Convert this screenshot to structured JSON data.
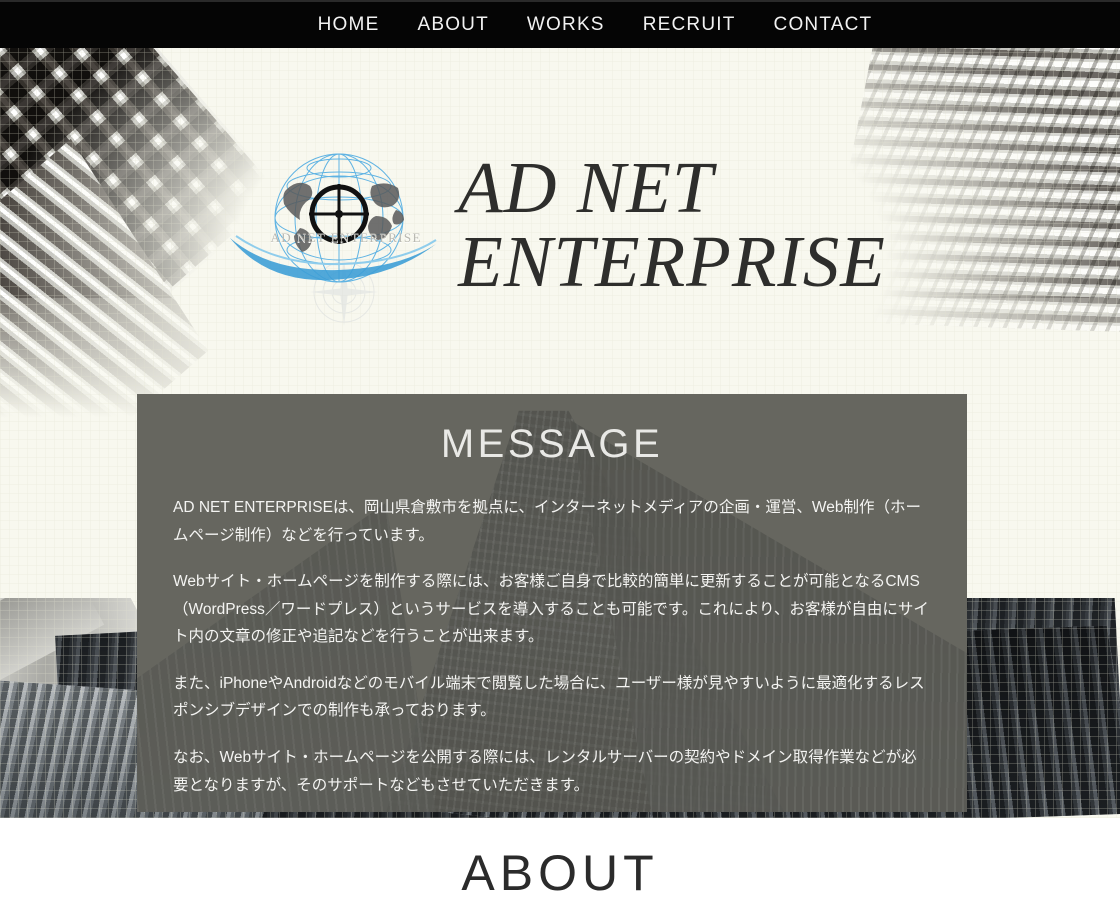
{
  "nav": {
    "items": [
      {
        "label": "HOME"
      },
      {
        "label": "ABOUT"
      },
      {
        "label": "WORKS"
      },
      {
        "label": "RECRUIT"
      },
      {
        "label": "CONTACT"
      }
    ]
  },
  "brand": {
    "logo_text": "AD NET ENTERPRISE",
    "wordmark_line1": "AD NET",
    "wordmark_line2": "ENTERPRISE"
  },
  "message": {
    "heading": "MESSAGE",
    "paragraphs": [
      "AD NET ENTERPRISEは、岡山県倉敷市を拠点に、インターネットメディアの企画・運営、Web制作（ホームページ制作）などを行っています。",
      "Webサイト・ホームページを制作する際には、お客様ご自身で比較的簡単に更新することが可能となるCMS（WordPress／ワードプレス）というサービスを導入することも可能です。これにより、お客様が自由にサイト内の文章の修正や追記などを行うことが出来ます。",
      "また、iPhoneやAndroidなどのモバイル端末で閲覧した場合に、ユーザー様が見やすいように最適化するレスポンシブデザインでの制作も承っております。",
      "なお、Webサイト・ホームページを公開する際には、レンタルサーバーの契約やドメイン取得作業などが必要となりますが、そのサポートなどもさせていただきます。"
    ]
  },
  "about": {
    "heading": "ABOUT"
  },
  "colors": {
    "nav_background": "#050505",
    "hero_background": "#f8f8ef",
    "panel_background": "#63635d",
    "wordmark_color": "#2e2e2c",
    "logo_accent": "#4aa3d8",
    "page_background": "#ffffff"
  }
}
